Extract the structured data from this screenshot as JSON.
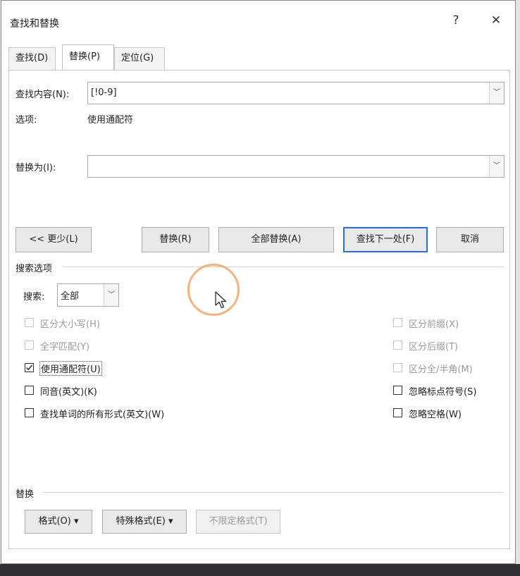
{
  "dialog": {
    "title": "查找和替换",
    "help_label": "?",
    "close_label": "✕"
  },
  "tabs": [
    {
      "label": "查找(D)",
      "active": false
    },
    {
      "label": "替换(P)",
      "active": true
    },
    {
      "label": "定位(G)",
      "active": false
    }
  ],
  "find": {
    "label": "查找内容(N):",
    "value": "[!0-9]",
    "options_label": "选项:",
    "options_value": "使用通配符"
  },
  "replace": {
    "label": "替换为(I):",
    "value": ""
  },
  "buttons": {
    "less": "<< 更少(L)",
    "replace": "替换(R)",
    "replace_all": "全部替换(A)",
    "find_next": "查找下一处(F)",
    "cancel": "取消"
  },
  "search_options": {
    "heading": "搜索选项",
    "search_label": "搜索:",
    "search_value": "全部",
    "left": [
      {
        "label": "区分大小写(H)",
        "checked": false,
        "disabled": true
      },
      {
        "label": "全字匹配(Y)",
        "checked": false,
        "disabled": true
      },
      {
        "label": "使用通配符(U)",
        "checked": true,
        "disabled": false
      },
      {
        "label": "同音(英文)(K)",
        "checked": false,
        "disabled": false
      },
      {
        "label": "查找单词的所有形式(英文)(W)",
        "checked": false,
        "disabled": false
      }
    ],
    "right": [
      {
        "label": "区分前缀(X)",
        "checked": false,
        "disabled": true
      },
      {
        "label": "区分后缀(T)",
        "checked": false,
        "disabled": true
      },
      {
        "label": "区分全/半角(M)",
        "checked": false,
        "disabled": true
      },
      {
        "label": "忽略标点符号(S)",
        "checked": false,
        "disabled": false
      },
      {
        "label": "忽略空格(W)",
        "checked": false,
        "disabled": false
      }
    ]
  },
  "replace_section": {
    "heading": "替换",
    "format": "格式(O) ▾",
    "special": "特殊格式(E) ▾",
    "no_format": "不限定格式(T)"
  }
}
